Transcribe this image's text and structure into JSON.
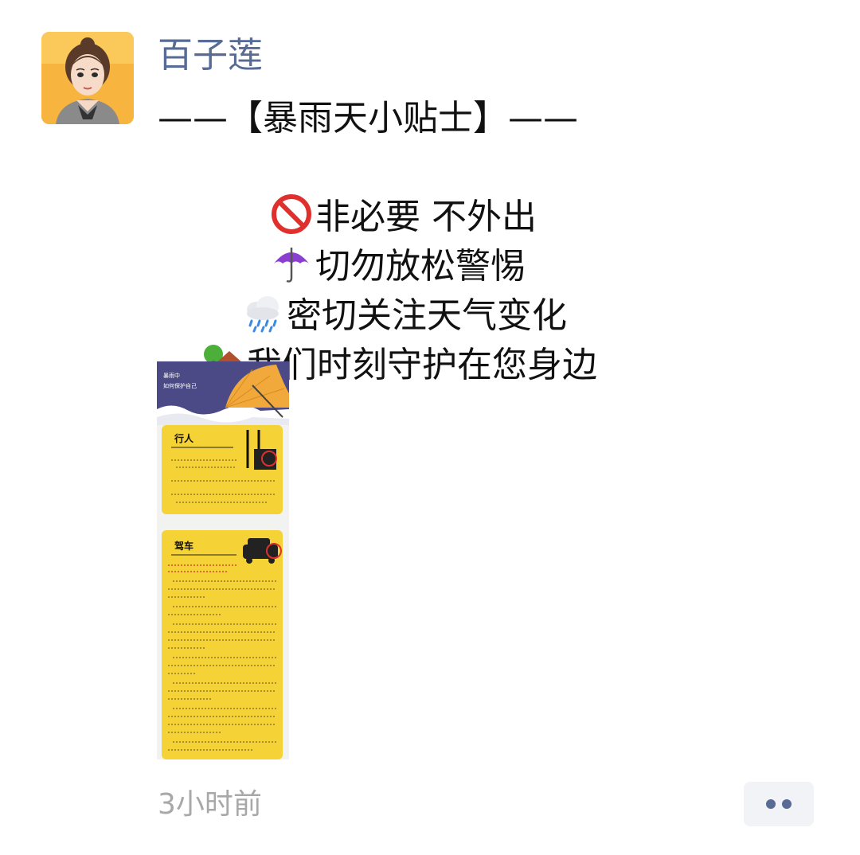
{
  "post": {
    "author": "百子莲",
    "lines": [
      "——【暴雨天小贴士】——",
      "非必要 不外出",
      "切勿放松警惕",
      "密切关注天气变化",
      "我们时刻守护在您身边"
    ],
    "icons": [
      "no-entry-icon",
      "umbrella-icon",
      "rain-cloud-icon",
      "house-tree-icon"
    ],
    "timestamp": "3小时前"
  },
  "image": {
    "header_line1": "暴雨中",
    "header_line2": "如何保护自己",
    "card1_title": "行人",
    "card2_title": "驾车"
  },
  "colors": {
    "name": "#576b95",
    "poster_yellow": "#f5d236",
    "poster_navy": "#4b4a86",
    "umbrella": "#f2a93b"
  }
}
